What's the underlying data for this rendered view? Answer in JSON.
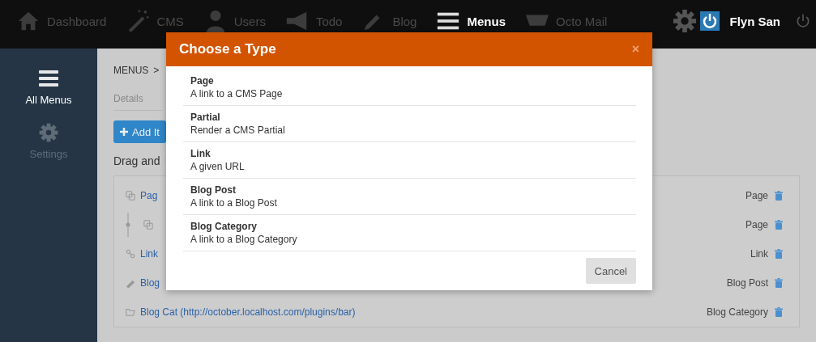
{
  "top_nav": {
    "items": [
      {
        "label": "Dashboard",
        "selected": false
      },
      {
        "label": "CMS",
        "selected": false
      },
      {
        "label": "Users",
        "selected": false
      },
      {
        "label": "Todo",
        "selected": false
      },
      {
        "label": "Blog",
        "selected": false
      },
      {
        "label": "Menus",
        "selected": true
      },
      {
        "label": "Octo Mail",
        "selected": false
      }
    ],
    "user": {
      "name": "Flyn San"
    }
  },
  "sidebar": {
    "items": [
      {
        "label": "All Menus",
        "selected": true
      },
      {
        "label": "Settings",
        "selected": false
      }
    ]
  },
  "breadcrumb": {
    "items": [
      "MENUS",
      ">"
    ]
  },
  "tabs": [
    {
      "label": "Details"
    }
  ],
  "add_button": {
    "label": "Add It"
  },
  "heading": "Drag and",
  "menu_items": [
    {
      "title": "Pag",
      "type": "Page",
      "kind": "page",
      "children": [
        {
          "type": "Page",
          "kind": "page"
        }
      ]
    },
    {
      "title": "Link",
      "type": "Link",
      "kind": "link"
    },
    {
      "title": "Blog",
      "type": "Blog Post",
      "kind": "post"
    },
    {
      "title": "Blog Cat (http://october.localhost.com/plugins/bar)",
      "type": "Blog Category",
      "kind": "category"
    }
  ],
  "modal": {
    "title": "Choose a Type",
    "close": "×",
    "options": [
      {
        "title": "Page",
        "description": "A link to a CMS Page"
      },
      {
        "title": "Partial",
        "description": "Render a CMS Partial"
      },
      {
        "title": "Link",
        "description": "A given URL"
      },
      {
        "title": "Blog Post",
        "description": "A link to a Blog Post"
      },
      {
        "title": "Blog Category",
        "description": "A link to a Blog Category"
      }
    ],
    "cancel": "Cancel"
  }
}
